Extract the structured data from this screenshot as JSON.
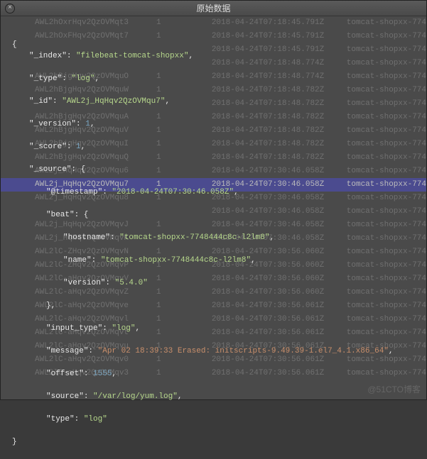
{
  "title": "原始数据",
  "watermark": "@51CTO博客",
  "json": {
    "brace_open": "{",
    "brace_close": "}",
    "obj_open": ": {",
    "obj_close": "},",
    "index_k": "\"_index\"",
    "index_v": "\"filebeat-tomcat-shopxx\"",
    "type_k": "\"_type\"",
    "type_v": "\"log\"",
    "id_k": "\"_id\"",
    "id_v": "\"AWL2j_HqHqv2QzOVMqu7\"",
    "version_k": "\"_version\"",
    "version_v": "1",
    "score_k": "\"_score\"",
    "score_v": "1",
    "source_k": "\"_source\"",
    "ts_k": "\"@timestamp\"",
    "ts_v": "\"2018-04-24T07:30:46.058Z\"",
    "beat_k": "\"beat\"",
    "hostname_k": "\"hostname\"",
    "hostname_v": "\"tomcat-shopxx-7748444c8c-l2lm8\"",
    "name_k": "\"name\"",
    "name_v": "\"tomcat-shopxx-7748444c8c-l2lm8\"",
    "bversion_k": "\"version\"",
    "bversion_v": "\"5.4.0\"",
    "input_type_k": "\"input_type\"",
    "input_type_v": "\"log\"",
    "message_k": "\"message\"",
    "message_v": "\"Apr 02 18:39:33 Erased: initscripts-9.49.39-1.el7_4.1.x86_64\"",
    "offset_k": "\"offset\"",
    "offset_v": "1555",
    "source2_k": "\"source\"",
    "source2_v": "\"/var/log/yum.log\"",
    "type2_k": "\"type\"",
    "type2_v": "\"log\"",
    "colon": ": ",
    "comma": ","
  },
  "bg_rows": [
    {
      "c1": "AWL2hOxrHqv2QzOVMqt3",
      "c2": "1",
      "c3": "2018-04-24T07:18:45.791Z",
      "c4": "tomcat-shopxx-774"
    },
    {
      "c1": "AWL2hOxFHqv2QzOVMqt7",
      "c2": "1",
      "c3": "2018-04-24T07:18:45.791Z",
      "c4": "tomcat-shopxx-774"
    },
    {
      "c1": "",
      "c2": "",
      "c3": "2018-04-24T07:18:45.791Z",
      "c4": "tomcat-shopxx-774"
    },
    {
      "c1": "",
      "c2": "",
      "c3": "2018-04-24T07:18:48.774Z",
      "c4": "tomcat-shopxx-774"
    },
    {
      "c1": "AWL2hBjgHqv2QzOVMquO",
      "c2": "1",
      "c3": "2018-04-24T07:18:48.774Z",
      "c4": "tomcat-shopxx-774"
    },
    {
      "c1": "AWL2hBjgHqv2QzOVMquW",
      "c2": "1",
      "c3": "2018-04-24T07:18:48.782Z",
      "c4": "tomcat-shopxx-774"
    },
    {
      "c1": "",
      "c2": "",
      "c3": "2018-04-24T07:18:48.782Z",
      "c4": "tomcat-shopxx-774"
    },
    {
      "c1": "AWL2hBjgHqv2QzOVMquA",
      "c2": "1",
      "c3": "2018-04-24T07:18:48.782Z",
      "c4": "tomcat-shopxx-774"
    },
    {
      "c1": "AWL2hBjgHqv2QzOVMquV",
      "c2": "1",
      "c3": "2018-04-24T07:18:48.782Z",
      "c4": "tomcat-shopxx-774"
    },
    {
      "c1": "AWL2hBjgHqv2QzOVMquI",
      "c2": "1",
      "c3": "2018-04-24T07:18:48.782Z",
      "c4": "tomcat-shopxx-774"
    },
    {
      "c1": "AWL2hBjgHqv2QzOVMquQ",
      "c2": "1",
      "c3": "2018-04-24T07:18:48.782Z",
      "c4": "tomcat-shopxx-774"
    },
    {
      "c1": "AWL2j_HqHqv2QzOVMqu6",
      "c2": "1",
      "c3": "2018-04-24T07:30:46.058Z",
      "c4": "tomcat-shopxx-774"
    },
    {
      "c1": "AWL2j_HqHqv2QzOVMqu7",
      "c2": "1",
      "c3": "2018-04-24T07:30:46.058Z",
      "c4": "tomcat-shopxx-774",
      "hl": true
    },
    {
      "c1": "AWL2j_HqHqv2QzOVMqu8",
      "c2": "1",
      "c3": "2018-04-24T07:30:46.058Z",
      "c4": "tomcat-shopxx-774"
    },
    {
      "c1": "",
      "c2": "",
      "c3": "2018-04-24T07:30:46.058Z",
      "c4": "tomcat-shopxx-774"
    },
    {
      "c1": "AWL2j_HqHqv2QzOVMqvJ",
      "c2": "1",
      "c3": "2018-04-24T07:30:46.058Z",
      "c4": "tomcat-shopxx-774"
    },
    {
      "c1": "AWL2j_HqHqv2QzOVMqvK",
      "c2": "1",
      "c3": "2018-04-24T07:30:46.058Z",
      "c4": "tomcat-shopxx-774"
    },
    {
      "c1": "AWL2lC-ZHqv2QzOVMqvN",
      "c2": "1",
      "c3": "2018-04-24T07:30:56.060Z",
      "c4": "tomcat-shopxx-774"
    },
    {
      "c1": "AWL2lC-ZHqv2QzOVMqvP",
      "c2": "1",
      "c3": "2018-04-24T07:30:56.060Z",
      "c4": "tomcat-shopxx-774"
    },
    {
      "c1": "AWL2lC-aHqv2QzOVMqvV",
      "c2": "1",
      "c3": "2018-04-24T07:30:56.060Z",
      "c4": "tomcat-shopxx-774"
    },
    {
      "c1": "AWL2lC-aHqv2QzOVMqvZ",
      "c2": "1",
      "c3": "2018-04-24T07:30:56.060Z",
      "c4": "tomcat-shopxx-774"
    },
    {
      "c1": "AWL2lC-aHqv2QzOVMqve",
      "c2": "1",
      "c3": "2018-04-24T07:30:56.061Z",
      "c4": "tomcat-shopxx-774"
    },
    {
      "c1": "AWL2lC-aHqv2QzOVMqvl",
      "c2": "1",
      "c3": "2018-04-24T07:30:56.061Z",
      "c4": "tomcat-shopxx-774"
    },
    {
      "c1": "AWL2lC-aHqv2QzOVMqvt",
      "c2": "1",
      "c3": "2018-04-24T07:30:56.061Z",
      "c4": "tomcat-shopxx-774"
    },
    {
      "c1": "AWL2lC-aHqv2QzOVMqvu",
      "c2": "1",
      "c3": "2018-04-24T07:30:56.061Z",
      "c4": "tomcat-shopxx-774"
    },
    {
      "c1": "AWL2lC-aHqv2QzOVMqv0",
      "c2": "1",
      "c3": "2018-04-24T07:30:56.061Z",
      "c4": "tomcat-shopxx-774"
    },
    {
      "c1": "AWL2lC-aHqv2QzOVMqv3",
      "c2": "1",
      "c3": "2018-04-24T07:30:56.061Z",
      "c4": "tomcat-shopxx-774"
    },
    {
      "c1": "",
      "c2": "",
      "c3": "",
      "c4": ""
    }
  ]
}
